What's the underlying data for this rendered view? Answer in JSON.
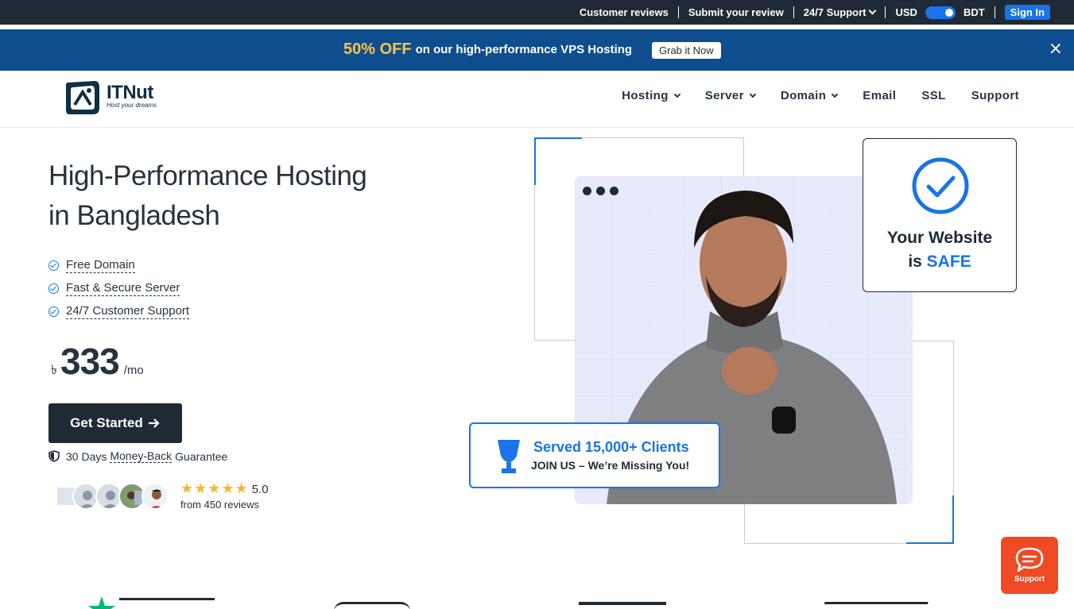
{
  "topbar": {
    "customer_reviews": "Customer reviews",
    "submit_review": "Submit your review",
    "support": "24/7 Support",
    "currency_left": "USD",
    "currency_right": "BDT",
    "sign_in": "Sign In"
  },
  "promo": {
    "highlight": "50% OFF",
    "text": "on our high-performance VPS Hosting",
    "button": "Grab it Now",
    "close": "×"
  },
  "brand": {
    "name": "ITNut",
    "tagline": "Host your dreams"
  },
  "nav": {
    "items": [
      {
        "label": "Hosting",
        "dropdown": true
      },
      {
        "label": "Server",
        "dropdown": true
      },
      {
        "label": "Domain",
        "dropdown": true
      },
      {
        "label": "Email",
        "dropdown": false
      },
      {
        "label": "SSL",
        "dropdown": false
      },
      {
        "label": "Support",
        "dropdown": false
      }
    ]
  },
  "hero": {
    "title_line1": "High-Performance Hosting",
    "title_line2": "in Bangladesh",
    "features": [
      "Free Domain",
      "Fast & Secure Server",
      "24/7 Customer Support"
    ],
    "currency_symbol": "৳",
    "price": "333",
    "per": "/mo",
    "cta": "Get Started",
    "guarantee_before": "30 Days",
    "guarantee_link": "Money-Back",
    "guarantee_after": "Guarantee",
    "stars": "★★★★★",
    "rating": "5.0",
    "reviews": "from 450 reviews"
  },
  "safe_card": {
    "line1": "Your Website",
    "line2_prefix": "is",
    "line2_highlight": "SAFE"
  },
  "clients_card": {
    "title": "Served 15,000+ Clients",
    "subtitle": "JOIN US – We’re Missing You!"
  },
  "support_widget": {
    "label": "Support"
  },
  "colors": {
    "dark": "#1e2a35",
    "primary": "#1a73e8",
    "promo_bg": "#0f4e8e",
    "promo_highlight": "#f7c548",
    "support_bg": "#f04a24",
    "star": "#f5b82e"
  }
}
